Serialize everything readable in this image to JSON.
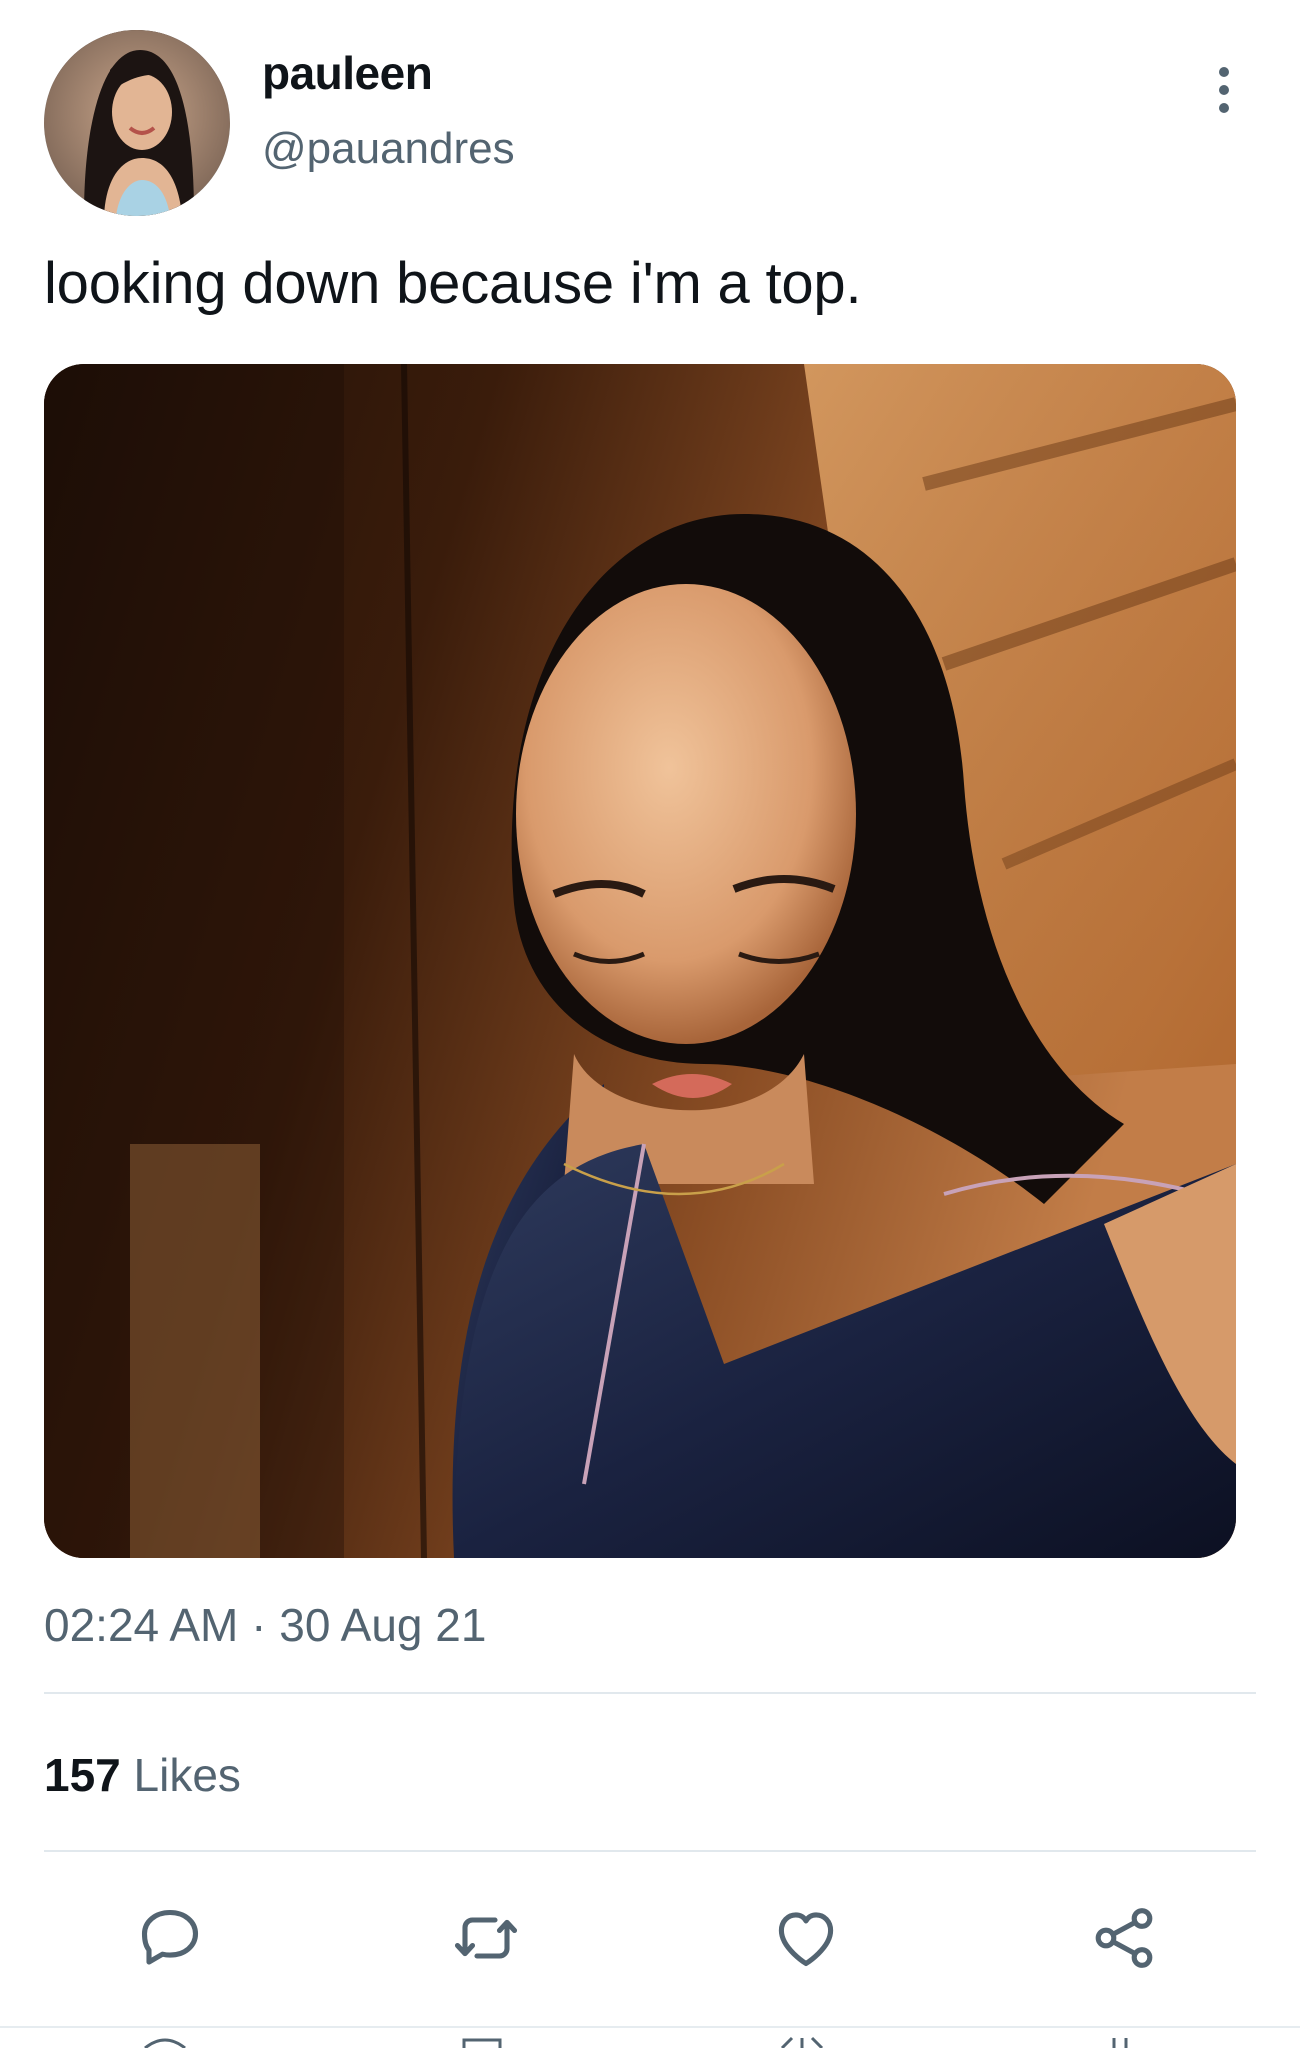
{
  "user": {
    "display_name": "pauleen",
    "handle": "@pauandres"
  },
  "tweet": {
    "text": "looking down because i'm a top.",
    "timestamp": "02:24 AM · 30 Aug 21",
    "likes_count": "157",
    "likes_label": "Likes"
  },
  "icons": {
    "more": "more-vertical-icon",
    "reply": "reply-icon",
    "retweet": "retweet-icon",
    "like": "heart-icon",
    "share": "share-icon"
  },
  "colors": {
    "text_primary": "#0f1419",
    "text_secondary": "#536471",
    "divider": "#e1e8ed"
  }
}
